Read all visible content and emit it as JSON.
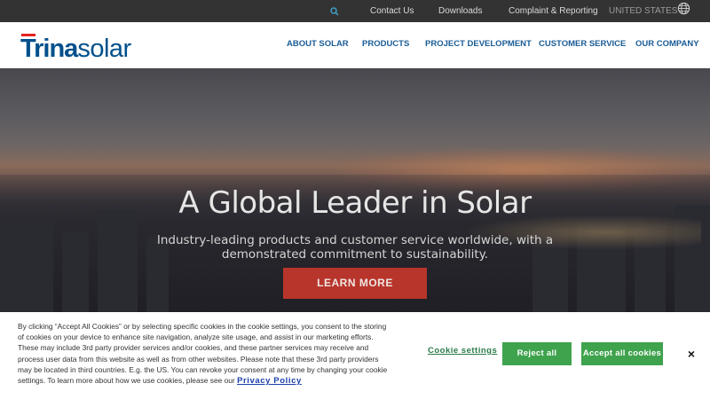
{
  "topbar": {
    "search_icon": "search-icon",
    "contact": "Contact Us",
    "downloads": "Downloads",
    "complaint": "Complaint & Reporting",
    "country": "UNITED STATES",
    "globe_icon": "globe-icon"
  },
  "brand": {
    "name_bold": "Trina",
    "name_light": "solar",
    "color": "#00508c",
    "accent": "#e2231a"
  },
  "nav": {
    "items": [
      {
        "label": "ABOUT SOLAR"
      },
      {
        "label": "PRODUCTS"
      },
      {
        "label": "PROJECT DEVELOPMENT"
      },
      {
        "label": "CUSTOMER SERVICE"
      },
      {
        "label": "OUR COMPANY"
      }
    ]
  },
  "hero": {
    "title": "A Global Leader in Solar",
    "subtitle": "Industry-leading products and customer service worldwide, with a demonstrated commitment to sustainability.",
    "cta": "LEARN MORE",
    "cta_color": "#b8352b"
  },
  "cookie": {
    "text": "By clicking “Accept All Cookies” or by selecting specific cookies in the cookie settings, you consent to the storing of cookies on your device to enhance site navigation, analyze site usage, and assist in our marketing efforts. These may include 3rd party provider services and/or cookies, and these partner services may receive and process user data from this website as well as from other websites. Please note that these 3rd party providers may be located in third countries. E.g. the US. You can revoke your consent at any time by changing your cookie settings. To learn more about how we use cookies, please see our",
    "policy_link": "Privacy Policy",
    "settings": "Cookie settings",
    "reject": "Reject all",
    "accept": "Accept all cookies",
    "close": "×",
    "button_color": "#3fa34d"
  }
}
